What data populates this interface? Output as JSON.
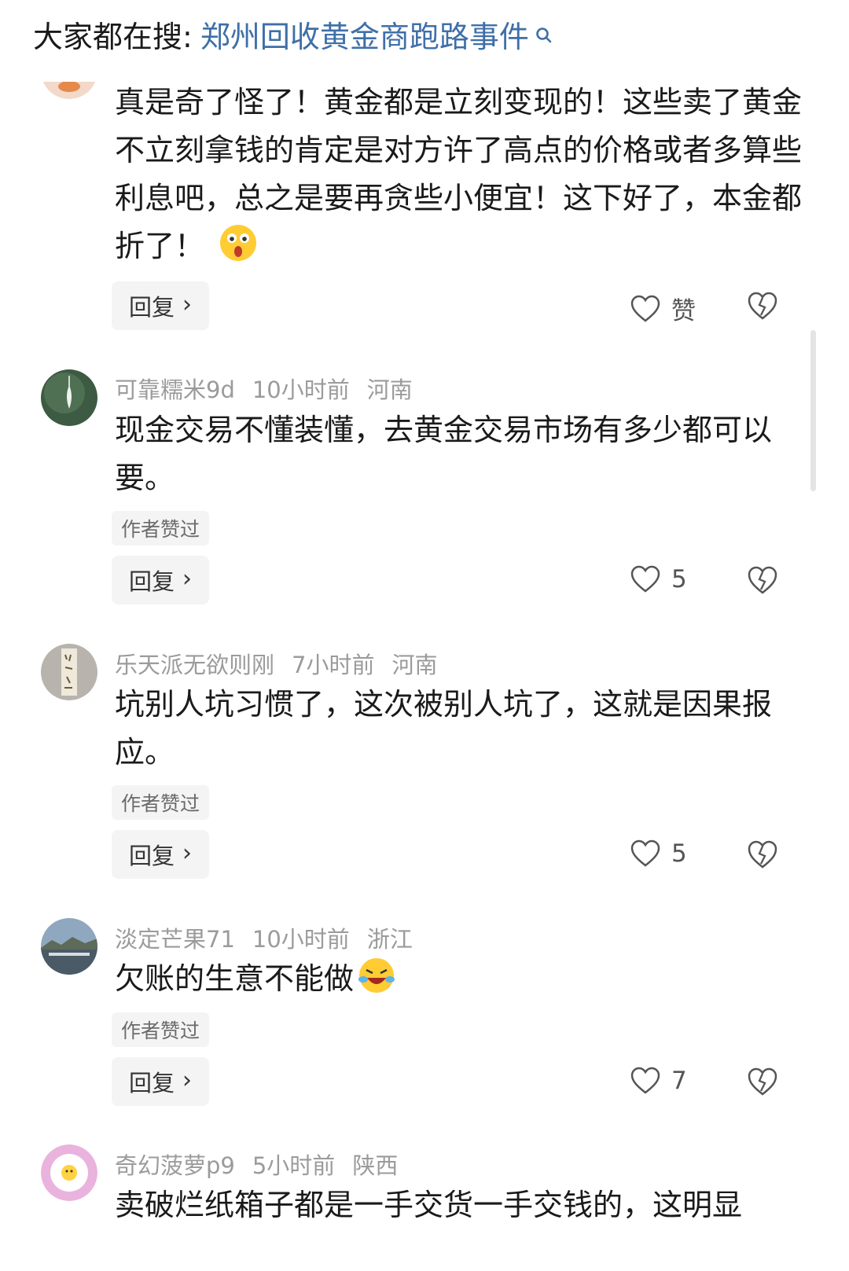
{
  "search": {
    "prefix": "大家都在搜:",
    "term": "郑州回收黄金商跑路事件"
  },
  "comments": [
    {
      "text": "真是奇了怪了！黄金都是立刻变现的！这些卖了黄金不立刻拿钱的肯定是对方许了高点的价格或者多算些利息吧，总之是要再贪些小便宜！这下好了，本金都折了！",
      "emoji": "astonished-face-emoji",
      "reply_label": "回复",
      "like_label": "赞"
    },
    {
      "user": "可靠糯米9d",
      "time": "10小时前",
      "location": "河南",
      "text": "现金交易不懂装懂，去黄金交易市场有多少都可以要。",
      "author_liked": "作者赞过",
      "reply_label": "回复",
      "like_count": "5"
    },
    {
      "user": "乐天派无欲则刚",
      "time": "7小时前",
      "location": "河南",
      "text": "坑别人坑习惯了，这次被别人坑了，这就是因果报应。",
      "author_liked": "作者赞过",
      "reply_label": "回复",
      "like_count": "5"
    },
    {
      "user": "淡定芒果71",
      "time": "10小时前",
      "location": "浙江",
      "text": "欠账的生意不能做",
      "emoji": "crying-laughing-emoji",
      "author_liked": "作者赞过",
      "reply_label": "回复",
      "like_count": "7"
    },
    {
      "user": "奇幻菠萝p9",
      "time": "5小时前",
      "location": "陕西",
      "text": "卖破烂纸箱子都是一手交货一手交钱的，这明显"
    }
  ],
  "colors": {
    "link": "#3f6fa8",
    "meta": "#9b9b9b",
    "badge_bg": "#f4f4f4"
  }
}
